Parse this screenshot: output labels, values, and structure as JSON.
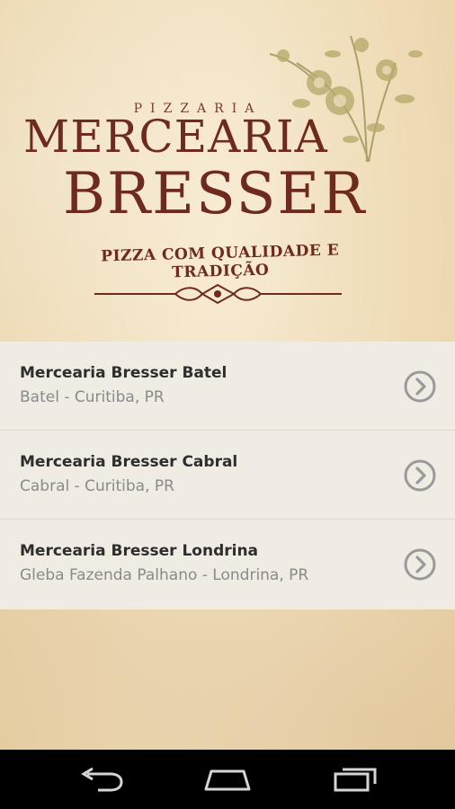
{
  "header": {
    "pizzaria": "PIZZARIA",
    "brand_line1": "MERCEARIA",
    "brand_line2": "BRESSER",
    "tagline": "PIZZA COM QUALIDADE E TRADIÇÃO"
  },
  "locations": [
    {
      "name": "Mercearia Bresser Batel",
      "address": "Batel - Curitiba, PR"
    },
    {
      "name": "Mercearia Bresser Cabral",
      "address": "Cabral - Curitiba, PR"
    },
    {
      "name": "Mercearia Bresser Londrina",
      "address": "Gleba Fazenda Palhano - Londrina, PR"
    }
  ],
  "icons": {
    "chevron": "chevron-right-circle-icon",
    "back": "back-icon",
    "home": "home-icon",
    "recents": "recent-apps-icon"
  },
  "colors": {
    "brand": "#6e2a1e",
    "list_background": "#f0ebe3",
    "title_text": "#2e2e2e",
    "subtitle_text": "#8a8a8a"
  }
}
